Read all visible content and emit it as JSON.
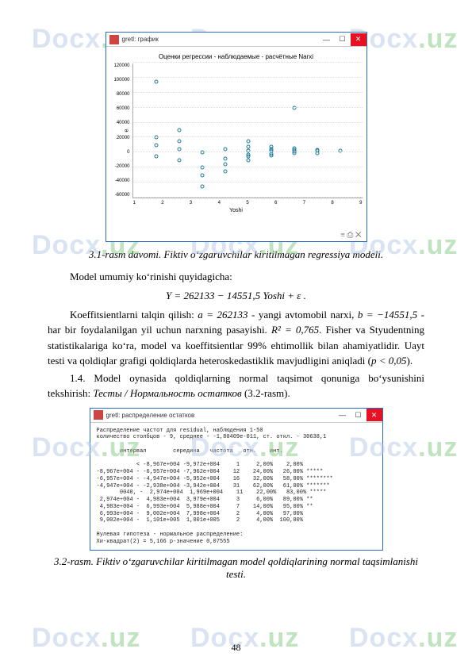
{
  "watermark": {
    "prefix": "Docx",
    "suffix": ".uz"
  },
  "scatter_window": {
    "app_title": "gretl: график",
    "chart_title": "Оценки регрессии - наблюдаемые - расчётные Narxi",
    "yaxis": "e",
    "xaxis": "Yoshi",
    "footer_icons": "≡  ⎙  ✕"
  },
  "chart_data": {
    "type": "scatter",
    "xlabel": "Yoshi",
    "ylabel": "e",
    "xlim": [
      0,
      10
    ],
    "ylim": [
      -60000,
      120000
    ],
    "xticks": [
      1,
      2,
      3,
      4,
      5,
      6,
      7,
      8,
      9
    ],
    "yticks": [
      -60000,
      -40000,
      -20000,
      0,
      20000,
      40000,
      60000,
      80000,
      100000,
      120000
    ],
    "points": [
      [
        1,
        20000
      ],
      [
        1,
        95000
      ],
      [
        1,
        10000
      ],
      [
        1,
        -5000
      ],
      [
        2,
        30000
      ],
      [
        2,
        -10000
      ],
      [
        2,
        15000
      ],
      [
        2,
        5000
      ],
      [
        3,
        -45000
      ],
      [
        3,
        -20000
      ],
      [
        3,
        -30000
      ],
      [
        3,
        0
      ],
      [
        4,
        -15000
      ],
      [
        4,
        5000
      ],
      [
        4,
        -25000
      ],
      [
        4,
        -8000
      ],
      [
        5,
        -5000
      ],
      [
        5,
        2000
      ],
      [
        5,
        -3000
      ],
      [
        5,
        -10000
      ],
      [
        5,
        8000
      ],
      [
        5,
        15000
      ],
      [
        6,
        -2000
      ],
      [
        6,
        3000
      ],
      [
        6,
        5000
      ],
      [
        6,
        -4000
      ],
      [
        6,
        8000
      ],
      [
        7,
        4000
      ],
      [
        7,
        1000
      ],
      [
        7,
        -1000
      ],
      [
        7,
        6000
      ],
      [
        7,
        60000
      ],
      [
        8,
        2000
      ],
      [
        8,
        4000
      ],
      [
        8,
        -500
      ],
      [
        9,
        3000
      ]
    ]
  },
  "caption1": "3.1-rasm davomi. Fiktiv oʻzgaruvchilar kiritilmagan regressiya modeli.",
  "para1": "Model umumiy koʻrinishi quyidagicha:",
  "formula": "Y = 262133 − 14551,5 Yoshi + ε .",
  "para2_prefix": "Koeffitsientlarni talqin qilish: ",
  "para2_a": "a = 262133",
  "para2_mid1": " - yangi avtomobil narxi, ",
  "para2_b": "b = −14551,5",
  "para2_tail": " - har bir foydalanilgan yil uchun narxning pasayishi. ",
  "para2_r2": "R² = 0,765",
  "para2_tail2": ". Fisher va Styudentning statistikalariga koʻra, model va koeffitsientlar 99% ehtimollik bilan ahamiyatlidir. Uayt testi va qoldiqlar grafigi qoldiqlarda heteroskedastiklik mavjudligini aniqladi (",
  "para2_p": "p < 0,05",
  "para2_close": ").",
  "para3": "1.4. Model oynasida qoldiqlarning normal taqsimot qonuniga boʻysunishini tekshirish: ",
  "para3_it": "Тесты / Нормальность остатков",
  "para3_tail": " (3.2-rasm).",
  "hist_window": {
    "app_title": "gretl: распределение остатков",
    "header1": "Распределение частот для residual, наблюдения 1-50",
    "header2": "количество столбцов - 9, среднее - -1,80409e-011, ст. откл. - 30638,1",
    "cols": "       интервал        середина   частота   отн.    инт.",
    "rows": [
      "            < -8,967e+004 -9,972e+004     1     2,00%    2,00% ",
      "-8,967e+004 - -6,957e+004 -7,962e+004    12    24,00%   26,00% *****",
      "-6,957e+004 - -4,947e+004 -5,952e+004    16    32,00%   58,00% ********",
      "-4,947e+004 - -2,938e+004 -3,942e+004    31    62,00%   61,00% *******",
      "       0040, -  2,974e+004  1,969e+004    11    22,00%   83,00% *****",
      " 2,974e+004 -  4,983e+004  3,979e+004     3     6,00%   89,00% **",
      " 4,983e+004 -  6,993e+004  5,988e+004     7    14,00%   95,00% **",
      " 6,993e+004 -  9,002e+004  7,998e+004     2     4,00%   97,00% ",
      " 9,002e+004 -  1,101e+005  1,001e+005     2     4,00%  100,00% "
    ],
    "footer1": "Нулевая гипотеза - нормальное распределение:",
    "footer2": "Хи-квадрат(2) = 5,166 р-значение 0,07555"
  },
  "caption2": "3.2-rasm. Fiktiv oʻzgaruvchilar kiritilmagan model qoldiqlarining normal taqsimlanishi testi.",
  "page_number": "48"
}
